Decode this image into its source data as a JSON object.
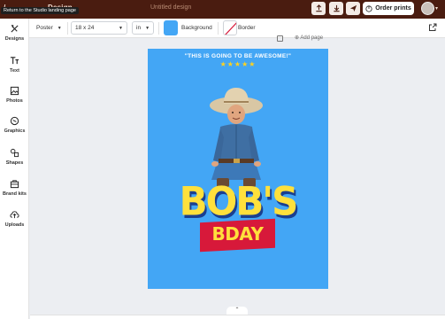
{
  "brand": {
    "left_text": "/ ",
    "right_text": "Design"
  },
  "tooltip": "Return to the Studio landing page",
  "document_title": "Untitled design",
  "topbar": {
    "buttons": [
      {
        "name": "upload-icon"
      },
      {
        "name": "download-icon"
      },
      {
        "name": "send-icon"
      }
    ],
    "order_prints_label": "Order prints"
  },
  "sidebar": {
    "items": [
      {
        "label": "Designs",
        "icon": "designs-icon"
      },
      {
        "label": "Text",
        "icon": "text-icon"
      },
      {
        "label": "Photos",
        "icon": "photos-icon"
      },
      {
        "label": "Graphics",
        "icon": "graphics-icon"
      },
      {
        "label": "Shapes",
        "icon": "shapes-icon"
      },
      {
        "label": "Brand kits",
        "icon": "brand-kits-icon"
      },
      {
        "label": "Uploads",
        "icon": "uploads-icon"
      }
    ]
  },
  "toolbar": {
    "product_type": "Poster",
    "size": "18 x 24",
    "unit": "in",
    "background_label": "Background",
    "background_color": "#43a6f5",
    "border_label": "Border"
  },
  "canvas": {
    "add_page_label": "Add page",
    "poster": {
      "quote": "\"THIS IS GOING TO BE AWESOME!\"",
      "stars": "★★★★★",
      "headline": "BOB'S",
      "subheadline": "BDAY"
    }
  },
  "colors": {
    "topbar": "#4a1c10",
    "accent_blue": "#43a6f5",
    "headline_yellow": "#ffe03c",
    "band_red": "#d7193a"
  }
}
